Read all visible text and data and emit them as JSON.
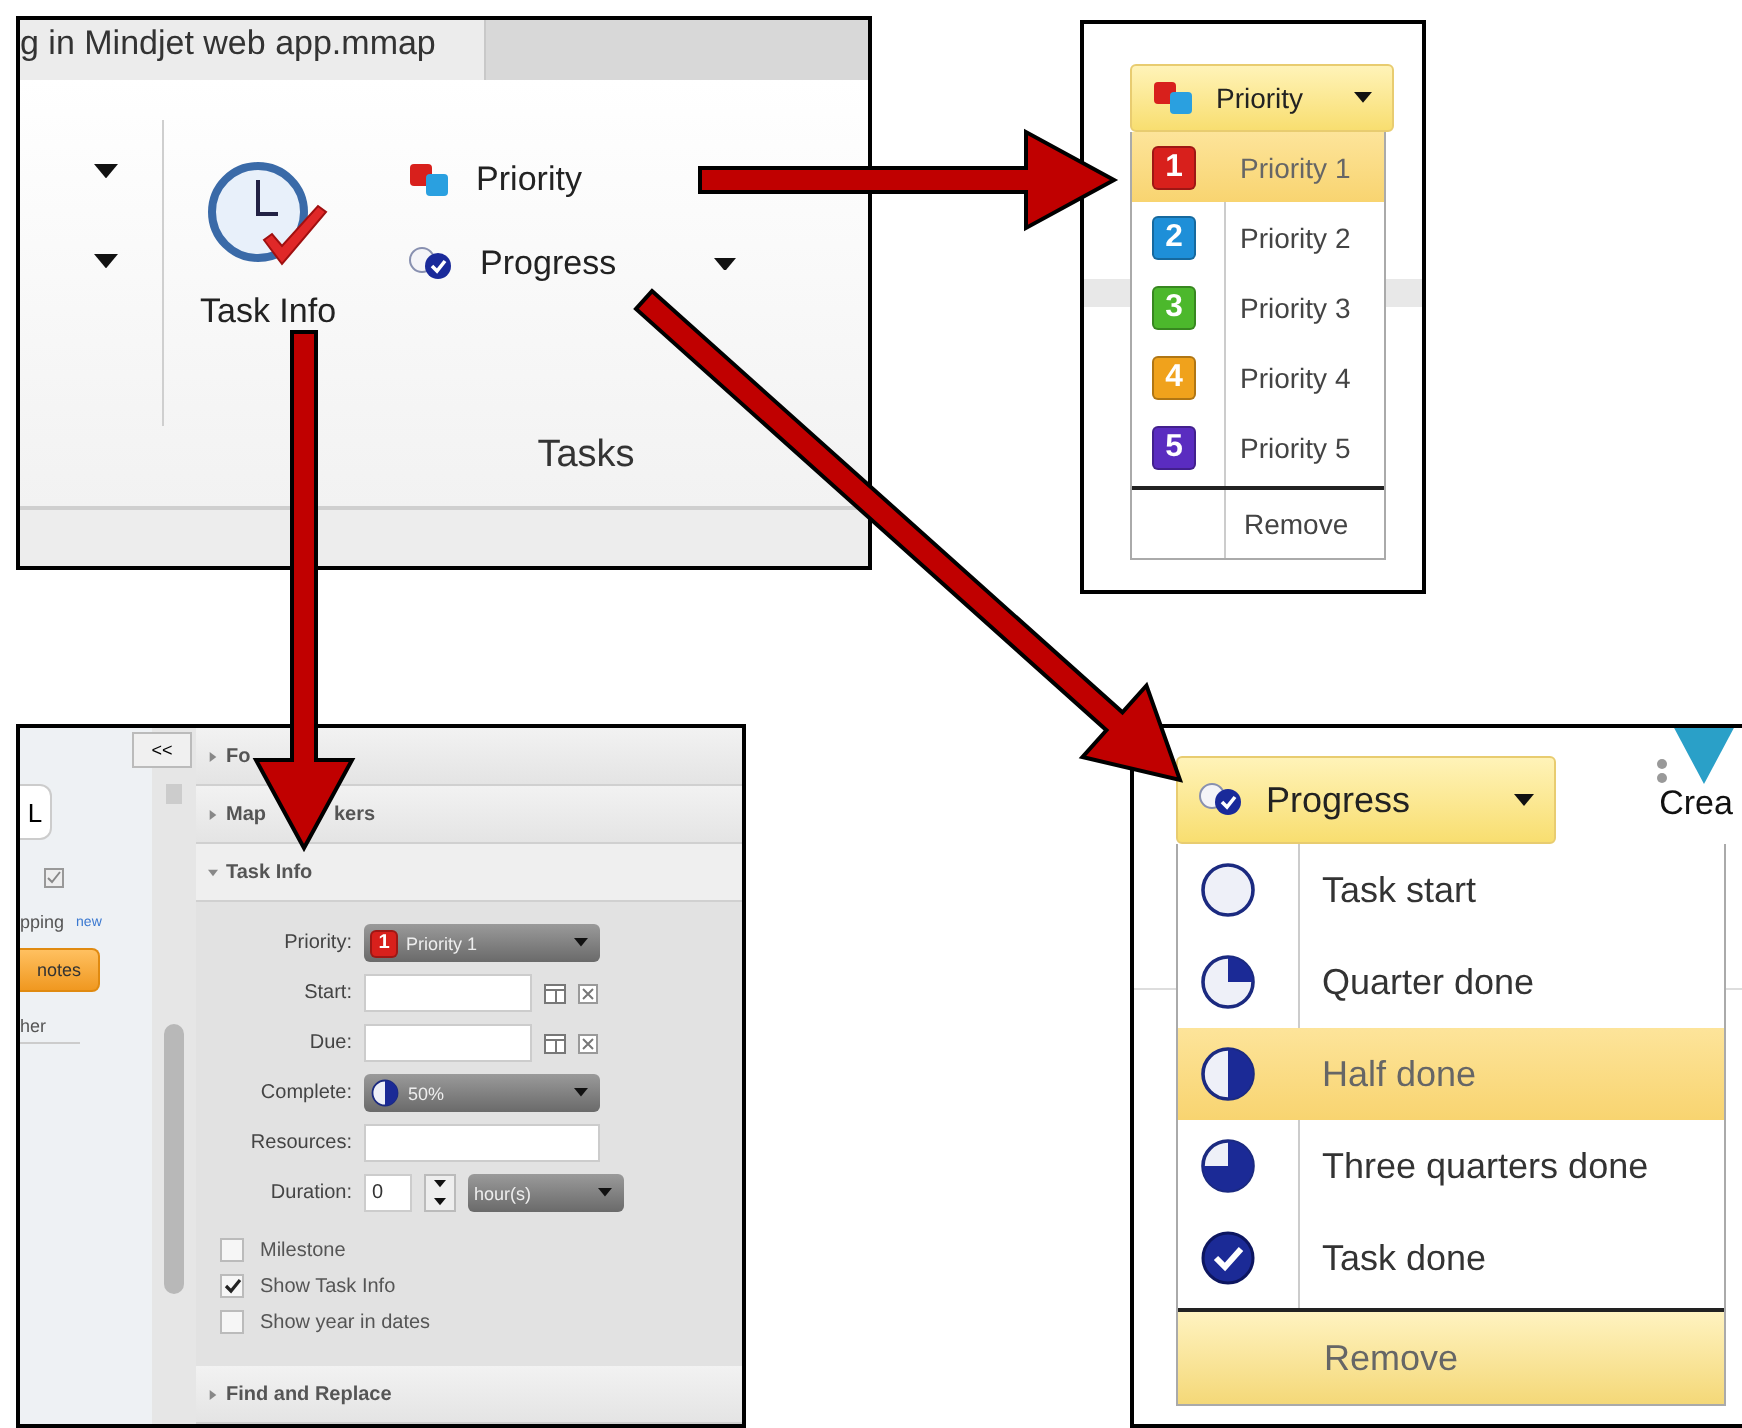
{
  "ribbon": {
    "tab_title": "g in Mindjet web app.mmap",
    "task_info_button": "Task Info",
    "buttons": [
      {
        "label": "Priority",
        "kind": "priority"
      },
      {
        "label": "Progress",
        "kind": "progress"
      }
    ],
    "group_label": "Tasks"
  },
  "priority_menu": {
    "button": "Priority",
    "items": [
      {
        "badge": "1",
        "label": "Priority 1",
        "color": "#d8201c",
        "selected": true
      },
      {
        "badge": "2",
        "label": "Priority 2",
        "color": "#1e8fd8",
        "selected": false
      },
      {
        "badge": "3",
        "label": "Priority 3",
        "color": "#4cb82c",
        "selected": false
      },
      {
        "badge": "4",
        "label": "Priority 4",
        "color": "#f0a21c",
        "selected": false
      },
      {
        "badge": "5",
        "label": "Priority 5",
        "color": "#5a2cc0",
        "selected": false
      }
    ],
    "remove": "Remove"
  },
  "task_panel": {
    "collapse_button": "<<",
    "sidebar": {
      "button": "L",
      "item": "pping",
      "badge": "new",
      "highlighted": "notes",
      "other": "her"
    },
    "sections": [
      {
        "label": "Fo",
        "expanded": false
      },
      {
        "label": "Map",
        "label_tail": "kers",
        "expanded": false
      },
      {
        "label": "Task Info",
        "expanded": true
      }
    ],
    "fields": [
      {
        "label": "Priority:",
        "kind": "priority",
        "badge": "1",
        "value": "Priority 1"
      },
      {
        "label": "Start:",
        "kind": "date"
      },
      {
        "label": "Due:",
        "kind": "date"
      },
      {
        "label": "Complete:",
        "kind": "progress",
        "value": "50%"
      },
      {
        "label": "Resources:",
        "kind": "text"
      },
      {
        "label": "Duration:",
        "kind": "duration",
        "value": "0",
        "unit": "hour(s)"
      }
    ],
    "checkboxes": [
      {
        "label": "Milestone",
        "checked": false
      },
      {
        "label": "Show Task Info",
        "checked": true
      },
      {
        "label": "Show year in dates",
        "checked": false
      }
    ],
    "footer_section": {
      "label": "Find and Replace",
      "expanded": false
    }
  },
  "progress_menu": {
    "button": "Progress",
    "side_text": "Crea",
    "items": [
      {
        "label": "Task start",
        "kind": "start",
        "selected": false
      },
      {
        "label": "Quarter done",
        "kind": "quarter",
        "selected": false
      },
      {
        "label": "Half done",
        "kind": "half",
        "selected": true
      },
      {
        "label": "Three quarters done",
        "kind": "three_quarters",
        "selected": false
      },
      {
        "label": "Task done",
        "kind": "done",
        "selected": false
      }
    ],
    "remove": "Remove",
    "remove_highlighted": true
  }
}
